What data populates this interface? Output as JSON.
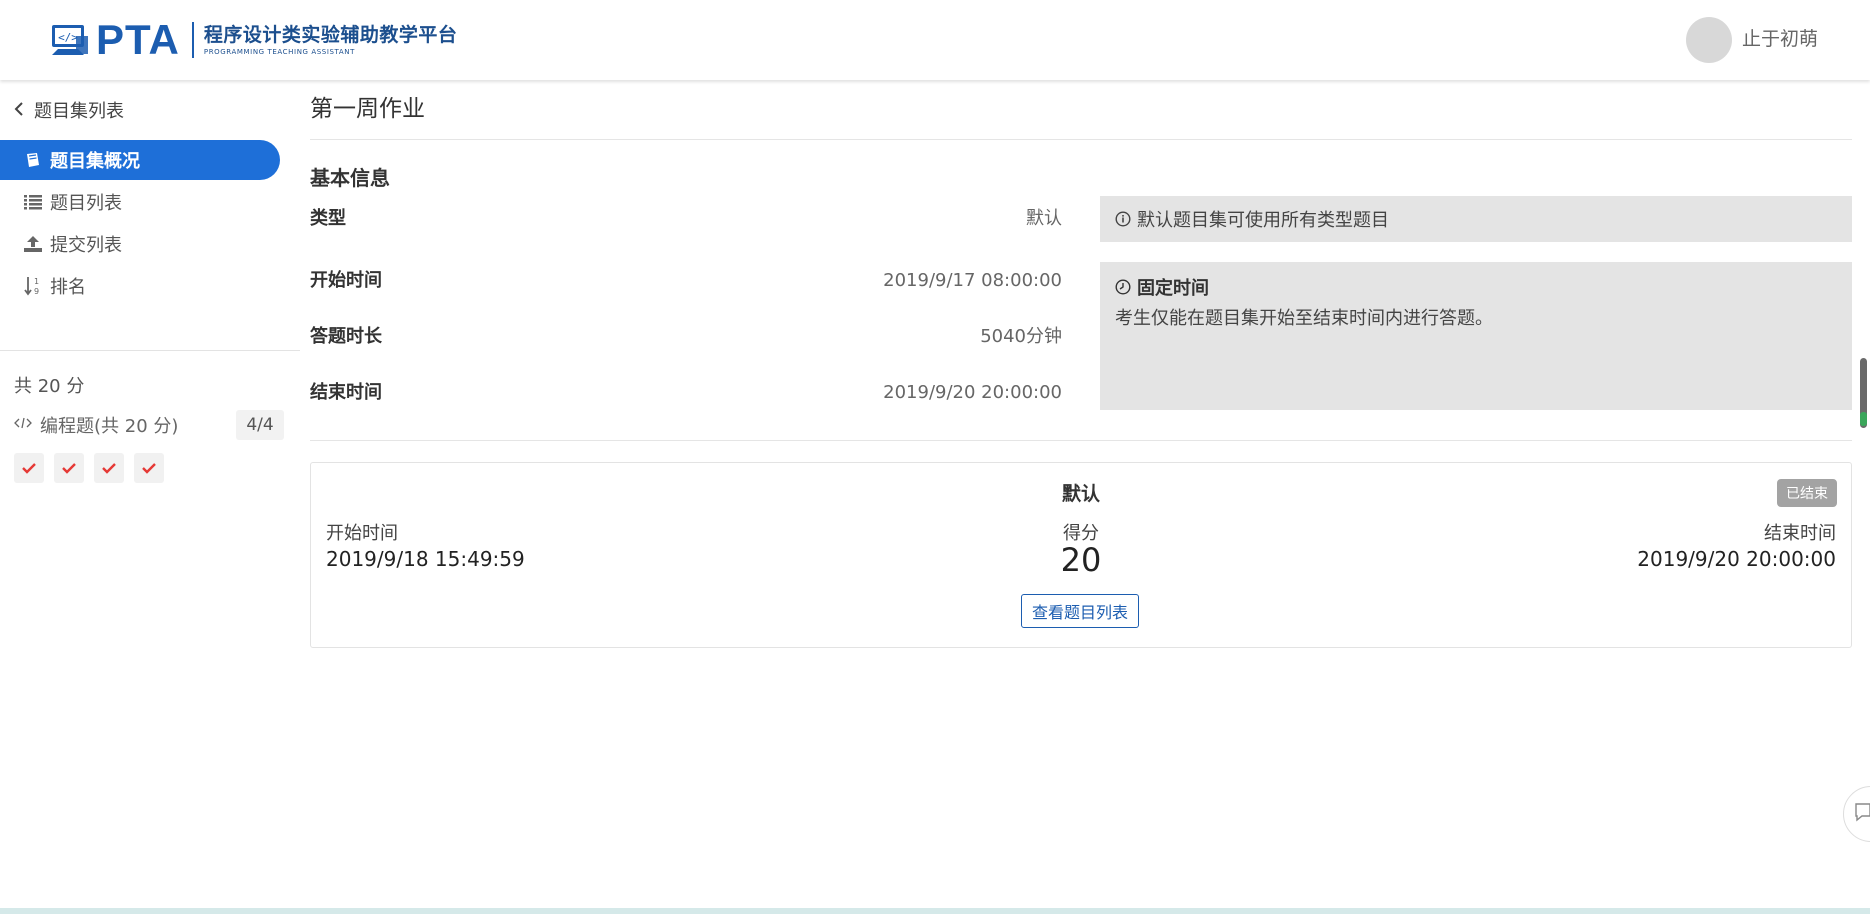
{
  "header": {
    "logo_text": "PTA",
    "logo_subtitle_cn": "程序设计类实验辅助教学平台",
    "logo_subtitle_en": "PROGRAMMING TEACHING ASSISTANT",
    "username": "止于初萌"
  },
  "sidebar": {
    "back_label": "题目集列表",
    "items": [
      {
        "label": "题目集概况",
        "icon": "book-icon",
        "active": true
      },
      {
        "label": "题目列表",
        "icon": "list-icon",
        "active": false
      },
      {
        "label": "提交列表",
        "icon": "upload-icon",
        "active": false
      },
      {
        "label": "排名",
        "icon": "sort-numeric-icon",
        "active": false
      }
    ],
    "total_score": "共 20 分",
    "category": {
      "label": "编程题(共 20 分)",
      "count": "4/4"
    },
    "problem_status": [
      "correct",
      "correct",
      "correct",
      "correct"
    ]
  },
  "main": {
    "title": "第一周作业",
    "section_title": "基本信息",
    "info": [
      {
        "label": "类型",
        "value": "默认"
      },
      {
        "label": "开始时间",
        "value": "2019/9/17 08:00:00"
      },
      {
        "label": "答题时长",
        "value": "5040分钟"
      },
      {
        "label": "结束时间",
        "value": "2019/9/20 20:00:00"
      }
    ],
    "type_note": "默认题目集可使用所有类型题目",
    "time_note_title": "固定时间",
    "time_note_body": "考生仅能在题目集开始至结束时间内进行答题。"
  },
  "card": {
    "title": "默认",
    "badge": "已结束",
    "start_label": "开始时间",
    "start_value": "2019/9/18 15:49:59",
    "score_label": "得分",
    "score_value": "20",
    "end_label": "结束时间",
    "end_value": "2019/9/20 20:00:00",
    "button_label": "查看题目列表"
  },
  "colors": {
    "brand": "#1c5db0",
    "active_nav": "#1e6fd8",
    "check": "#e53935",
    "badge": "#a3a3a3"
  }
}
